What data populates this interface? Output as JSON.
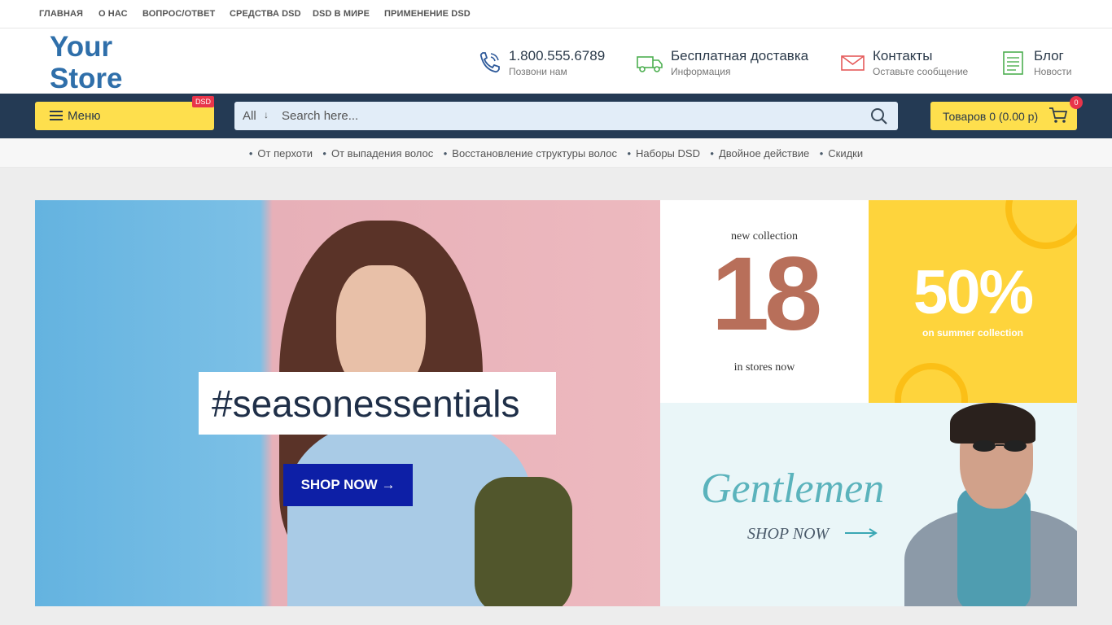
{
  "topnav": [
    "ГЛАВНАЯ",
    "О НАС",
    "ВОПРОС/ОТВЕТ",
    "СРЕДСТВА DSD",
    "DSD В МИРЕ",
    "ПРИМЕНЕНИЕ DSD"
  ],
  "logo": {
    "line1": "Your",
    "line2": "Store"
  },
  "header": {
    "phone": {
      "title": "1.800.555.6789",
      "subtitle": "Позвони нам",
      "icon": "phone-icon"
    },
    "delivery": {
      "title": "Бесплатная доставка",
      "subtitle": "Информация",
      "icon": "truck-icon"
    },
    "contacts": {
      "title": "Контакты",
      "subtitle": "Оставьте сообщение",
      "icon": "mail-icon"
    },
    "blog": {
      "title": "Блог",
      "subtitle": "Новости",
      "icon": "notepad-icon"
    }
  },
  "menu": {
    "label": "Меню",
    "badge": "DSD"
  },
  "search": {
    "category": "All",
    "placeholder": "Search here..."
  },
  "cart": {
    "label": "Товаров 0 (0.00 р)",
    "count": "0"
  },
  "categories": [
    "От перхоти",
    "От выпадения волос",
    "Восстановление структуры волос",
    "Наборы DSD",
    "Двойное действие",
    "Скидки"
  ],
  "banners": {
    "main": {
      "tag": "#seasonessentials",
      "button": "SHOP NOW"
    },
    "collection": {
      "top": "new collection",
      "number": "18",
      "bottom": "in stores now"
    },
    "sale": {
      "big": "50%",
      "small": "on summer collection"
    },
    "gentlemen": {
      "title": "Gentlemen",
      "shop": "SHOP NOW"
    }
  },
  "colors": {
    "accent_yellow": "#fedf4d",
    "navbar": "#243a54",
    "logo": "#2f6faa",
    "badge_red": "#e8354a",
    "shop_button": "#0d1fa6"
  }
}
